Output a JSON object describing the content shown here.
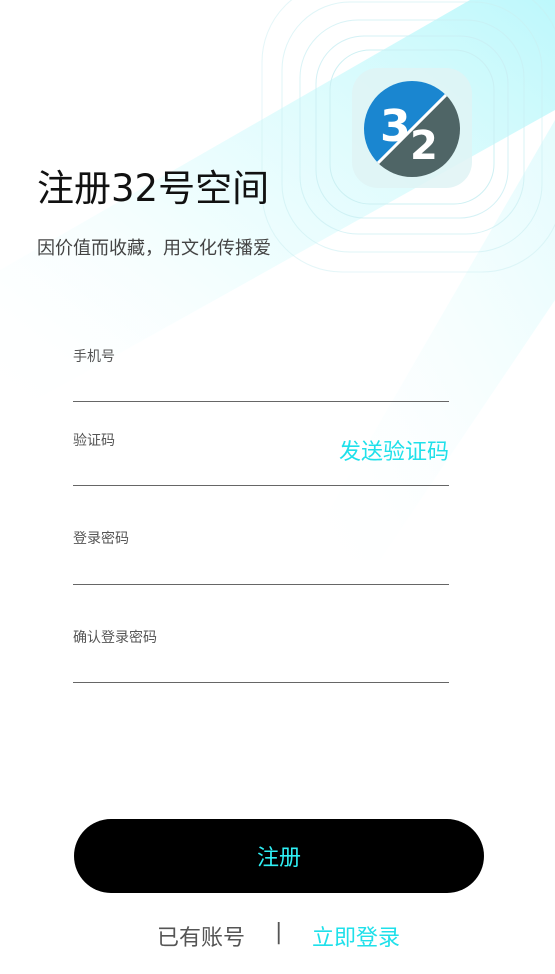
{
  "header": {
    "title": "注册32号空间",
    "subtitle": "因价值而收藏，用文化传播爱",
    "logo_text_top": "3",
    "logo_text_bottom": "2"
  },
  "form": {
    "phone_label": "手机号",
    "code_label": "验证码",
    "send_code_label": "发送验证码",
    "password_label": "登录密码",
    "confirm_password_label": "确认登录密码"
  },
  "actions": {
    "register_label": "注册",
    "has_account_text": "已有账号",
    "divider": "|",
    "login_label": "立即登录"
  },
  "colors": {
    "accent": "#1fe0ea",
    "button_bg": "#000000",
    "logo_blue": "#1a86d0",
    "logo_gray": "#4f6566"
  },
  "icons": {
    "logo": "32-logo-icon"
  }
}
